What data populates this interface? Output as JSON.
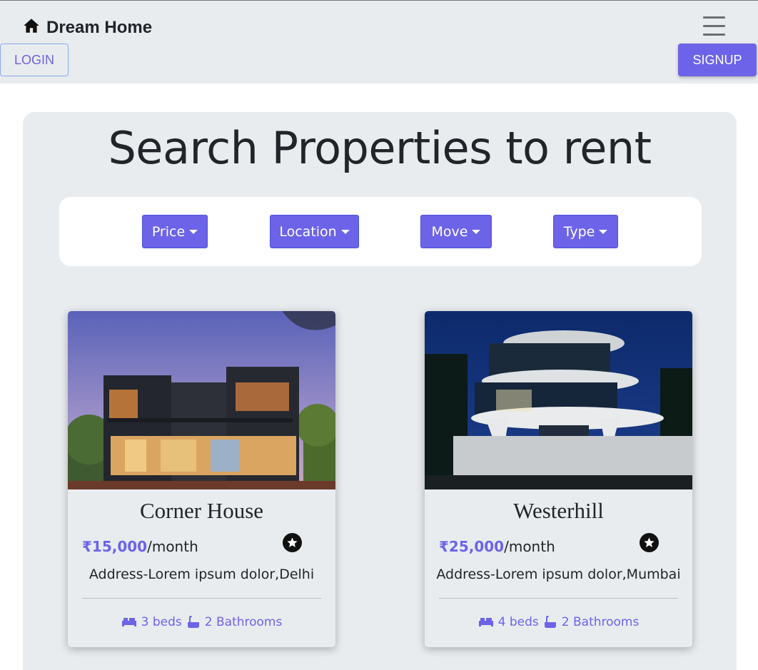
{
  "navbar": {
    "brand": "Dream Home",
    "brand_icon": "home-icon",
    "login_label": "LOGIN",
    "signup_label": "SIGNUP",
    "menu_icon": "hamburger-icon"
  },
  "search": {
    "title": "Search Properties to rent",
    "filters": [
      {
        "label": "Price"
      },
      {
        "label": "Location"
      },
      {
        "label": "Move"
      },
      {
        "label": "Type"
      }
    ]
  },
  "properties": [
    {
      "name": "Corner House",
      "price": "₹15,000",
      "period": "/month",
      "address": "Address-Lorem ipsum dolor,Delhi",
      "beds": "3 beds",
      "baths": "2 Bathrooms"
    },
    {
      "name": "Westerhill",
      "price": "₹25,000",
      "period": "/month",
      "address": "Address-Lorem ipsum dolor,Mumbai",
      "beds": "4 beds",
      "baths": "2 Bathrooms"
    }
  ],
  "colors": {
    "accent": "#6c63e8",
    "panel": "#e9ecef",
    "navbar": "#e9ecef"
  }
}
